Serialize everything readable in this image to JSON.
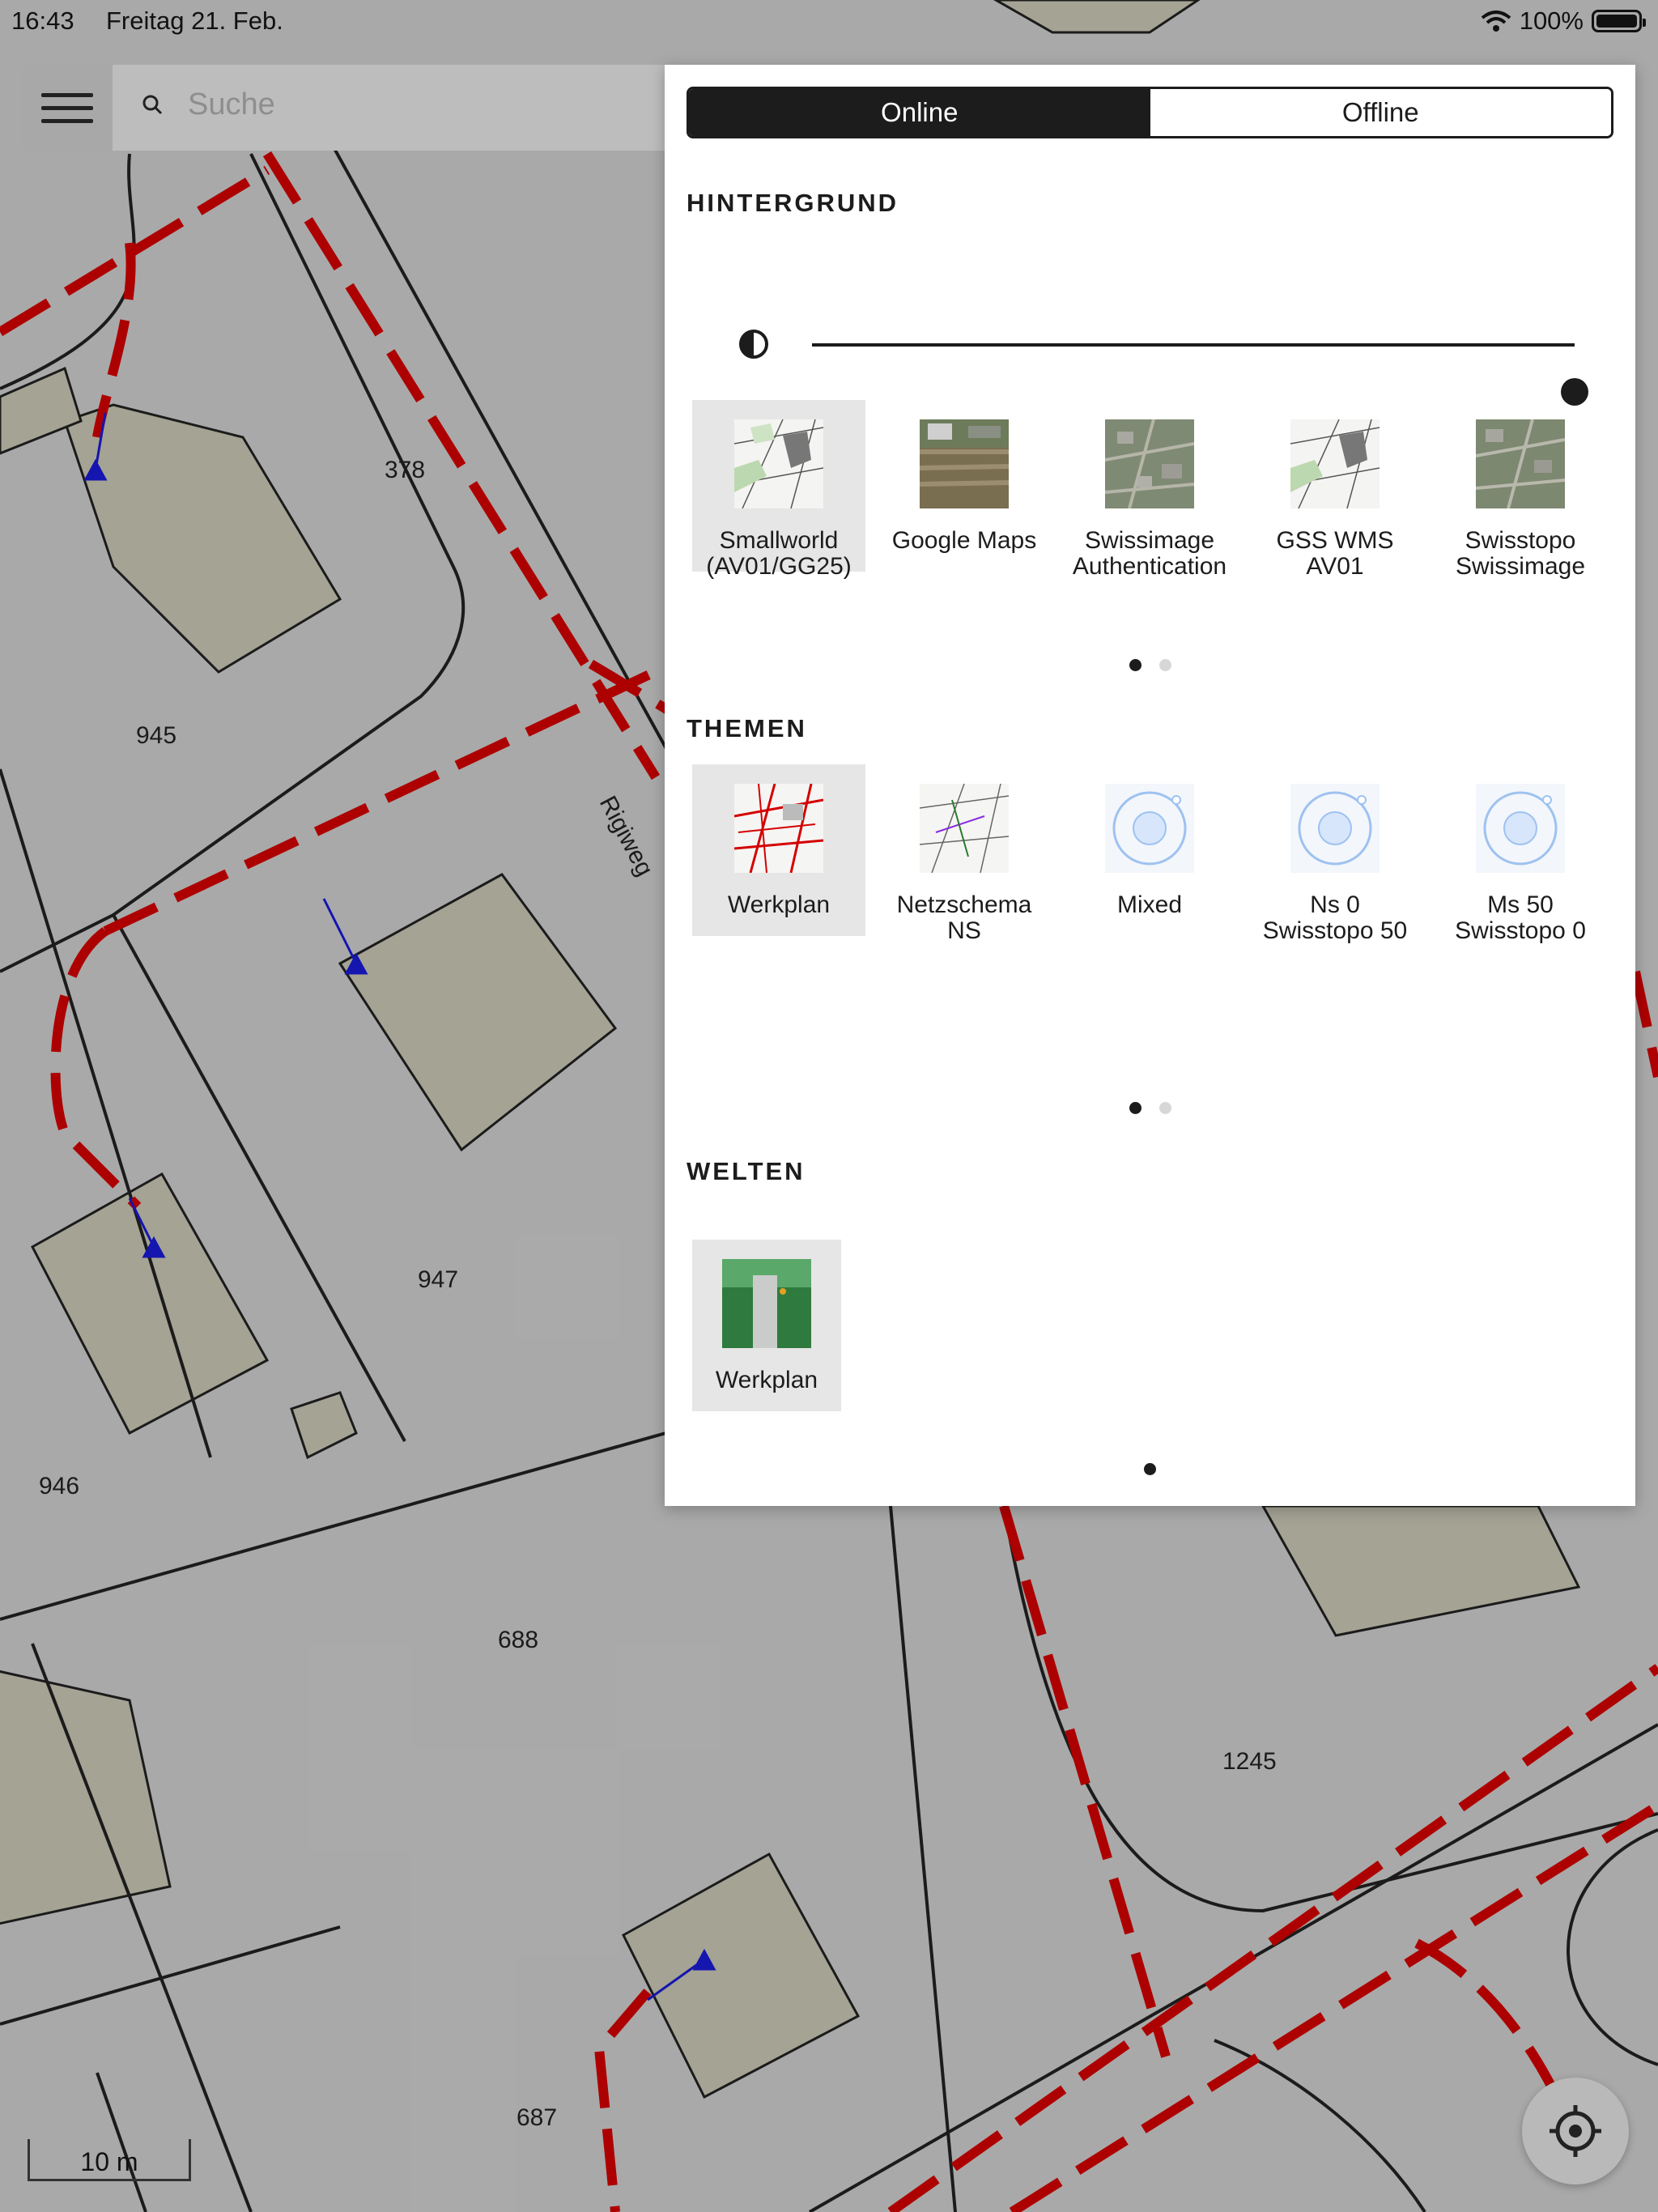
{
  "status_bar": {
    "time": "16:43",
    "date": "Freitag 21. Feb.",
    "battery": "100%"
  },
  "search": {
    "placeholder": "Suche",
    "menu_icon": "hamburger-icon",
    "search_icon": "search-icon"
  },
  "map": {
    "parcel_labels": [
      "378",
      "945",
      "947",
      "946",
      "688",
      "687",
      "1245"
    ],
    "street_labels": [
      "Rigiweg"
    ],
    "scale_label": "10 m",
    "locate_icon": "locate-icon"
  },
  "panel": {
    "mode_tabs": [
      {
        "label": "Online",
        "active": true
      },
      {
        "label": "Offline",
        "active": false
      }
    ],
    "background": {
      "title": "HINTERGRUND",
      "opacity_icon": "contrast-icon",
      "opacity_value": 1.0,
      "items": [
        {
          "label": "Smallworld\n(AV01/GG25)",
          "selected": true,
          "icon": "survey-map-thumbnail"
        },
        {
          "label": "Google Maps",
          "selected": false,
          "icon": "aerial-photo-thumbnail"
        },
        {
          "label": "Swissimage\nAuthentication",
          "selected": false,
          "icon": "aerial-photo-thumbnail"
        },
        {
          "label": "GSS WMS\nAV01",
          "selected": false,
          "icon": "survey-map-thumbnail"
        },
        {
          "label": "Swisstopo\nSwissimage",
          "selected": false,
          "icon": "aerial-photo-thumbnail"
        }
      ],
      "pages": 2,
      "page": 1
    },
    "themes": {
      "title": "THEMEN",
      "items": [
        {
          "label": "Werkplan",
          "selected": true,
          "icon": "werkplan-thumbnail"
        },
        {
          "label": "Netzschema\nNS",
          "selected": false,
          "icon": "network-schema-thumbnail"
        },
        {
          "label": "Mixed",
          "selected": false,
          "icon": "placeholder-globe-thumbnail"
        },
        {
          "label": "Ns 0\nSwisstopo 50",
          "selected": false,
          "icon": "placeholder-globe-thumbnail"
        },
        {
          "label": "Ms 50\nSwisstopo 0",
          "selected": false,
          "icon": "placeholder-globe-thumbnail"
        }
      ],
      "pages": 2,
      "page": 1
    },
    "worlds": {
      "title": "WELTEN",
      "items": [
        {
          "label": "Werkplan",
          "selected": true,
          "icon": "world-3d-thumbnail"
        }
      ],
      "pages": 1,
      "page": 1
    }
  },
  "colors": {
    "accent": "#1c1c1c",
    "network_line": "#d40000",
    "building": "#c8c7b5",
    "service_line": "#1a1ad6"
  }
}
